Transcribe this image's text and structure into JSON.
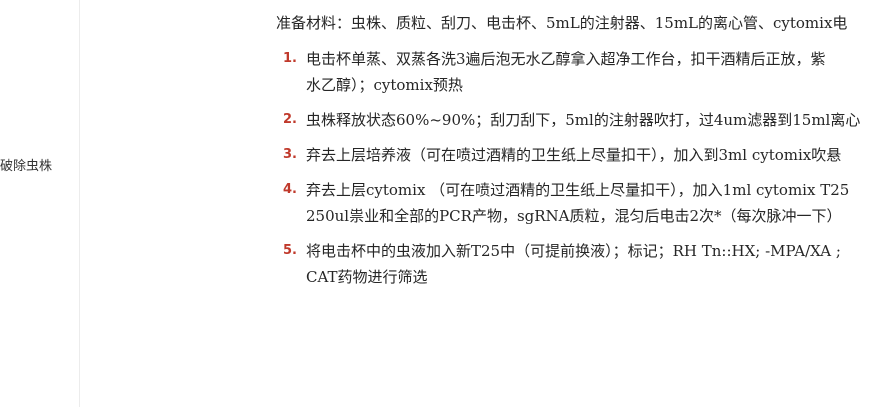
{
  "sidebar": {
    "label": "破除虫株"
  },
  "document": {
    "intro": "准备材料：虫株、质粒、刮刀、电击杯、5mL的注射器、15mL的离心管、cytomix电",
    "steps": [
      {
        "number": "1.",
        "lines": [
          "电击杯单蒸、双蒸各洗3遍后泡无水乙醇拿入超净工作台，扣干酒精后正放，紫",
          "水乙醇）；cytomix预热"
        ]
      },
      {
        "number": "2.",
        "lines": [
          "虫株释放状态60%~90%；刮刀刮下，5ml的注射器吹打，过4um滤器到15ml离心"
        ]
      },
      {
        "number": "3.",
        "lines": [
          "弃去上层培养液（可在喷过酒精的卫生纸上尽量扣干），加入到3ml cytomix吹悬"
        ]
      },
      {
        "number": "4.",
        "lines": [
          "弃去上层cytomix （可在喷过酒精的卫生纸上尽量扣干），加入1ml cytomix T25",
          "250ul祟业和全部的PCR产物，sgRNA质粒，混匀后电击2次*（每次脉冲一下）"
        ]
      },
      {
        "number": "5.",
        "lines": [
          "将电击杯中的虫液加入新T25中（可提前换液）；标记；RH Tn::HX; -MPA/XA ;",
          "CAT药物进行筛选"
        ]
      }
    ]
  }
}
